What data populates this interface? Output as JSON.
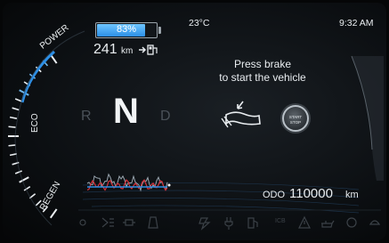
{
  "battery": {
    "percent_label": "83%",
    "level_fraction": 0.83,
    "color": "#2c8fe6"
  },
  "range": {
    "value": "241",
    "unit": "km"
  },
  "header": {
    "temperature": "23°C",
    "time": "9:32 AM"
  },
  "gear": {
    "reverse": "R",
    "neutral": "N",
    "drive": "D",
    "selected": "N"
  },
  "power_gauge": {
    "power_label": "POWER",
    "eco_label": "ECO",
    "regen_label": "REGEN"
  },
  "message": {
    "line1": "Press brake",
    "line2": "to start the vehicle"
  },
  "start_button": {
    "line1": "START",
    "line2": "STOP"
  },
  "odometer": {
    "label": "ODO",
    "value": "110000",
    "unit": "km"
  },
  "tell_tales": {
    "icons": [
      "seatbelt-icon",
      "headlight-icon",
      "parking-lamp-icon",
      "door-icon",
      "ev-mode-icon",
      "charging-plug-icon",
      "fuel-range-icon",
      "icb-icon",
      "warning-triangle-icon",
      "oil-can-icon",
      "engine-check-icon",
      "tpms-icon"
    ],
    "icb_label": "ICB"
  },
  "colors": {
    "accent_blue": "#2c8fe6",
    "text": "#e9edf0",
    "background": "#0b0e11"
  }
}
